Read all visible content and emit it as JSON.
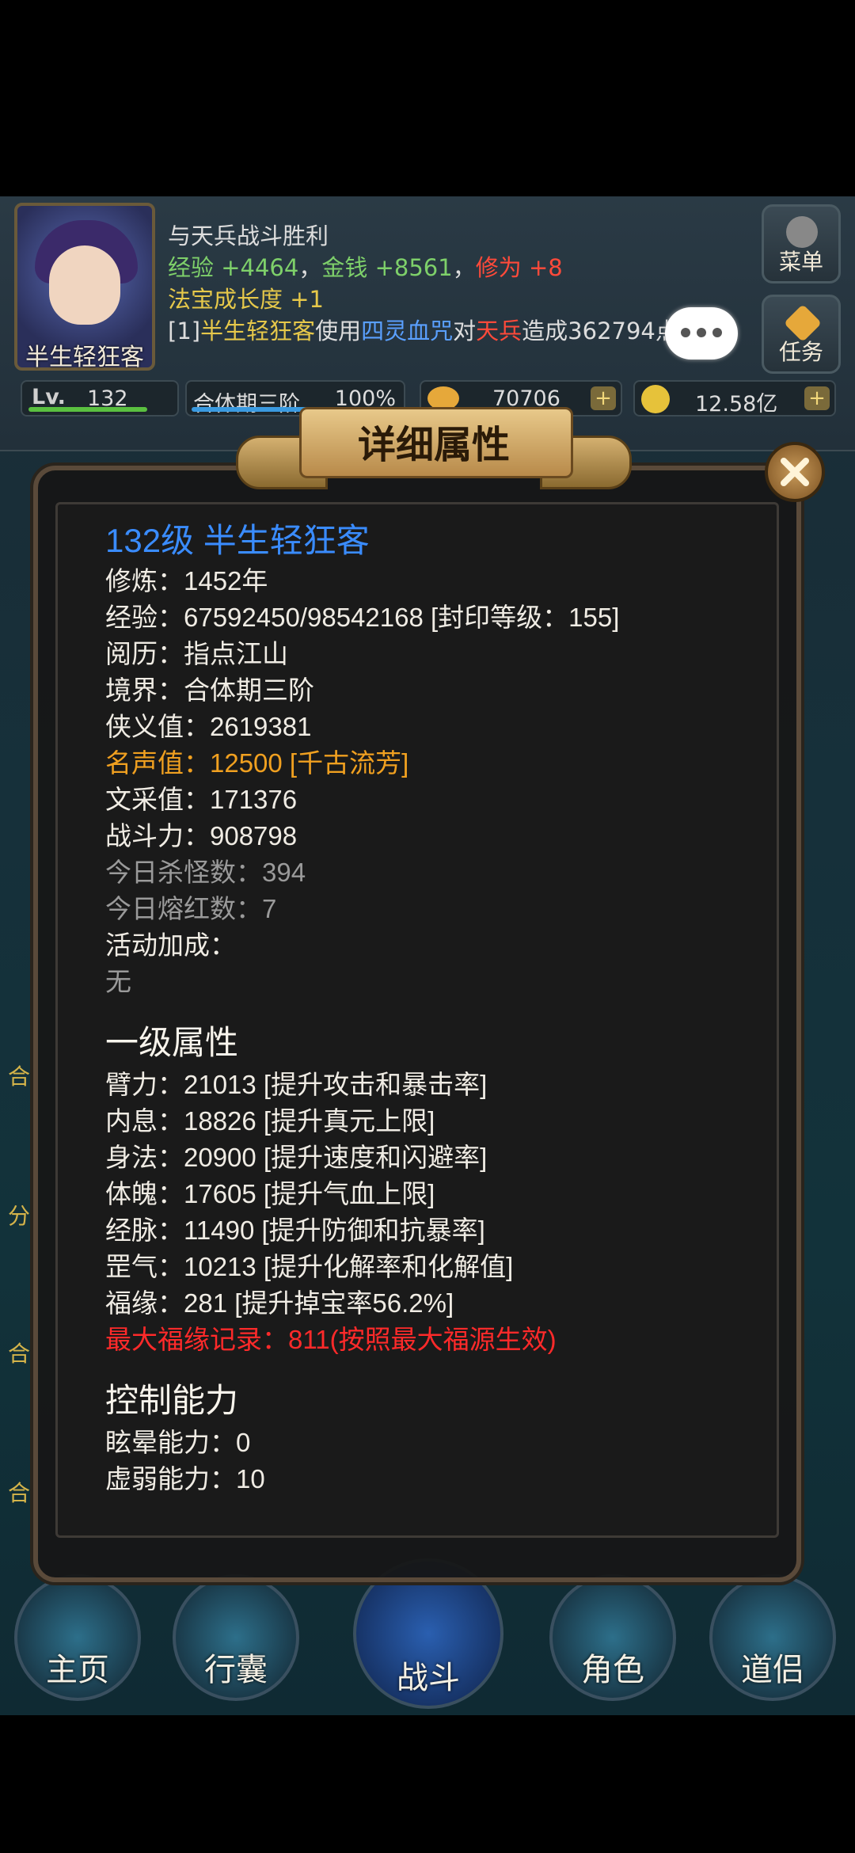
{
  "hud": {
    "player_name": "半生轻狂客",
    "log": {
      "line1": "与天兵战斗胜利",
      "exp_label": "经验",
      "exp_gain": "+4464",
      "comma1": "，",
      "money_label": "金钱",
      "money_gain": "+8561",
      "comma2": "，",
      "cult_label": "修为",
      "cult_gain": "+8",
      "treasure_label": "法宝成长度",
      "treasure_gain": "+1",
      "l4_prefix": "[1]",
      "l4_name": "半生轻狂客",
      "l4_use": "使用",
      "l4_skill": "四灵血咒",
      "l4_dui": "对",
      "l4_target": "天兵",
      "l4_rest": "造成362794点伤害"
    },
    "menu_label": "菜单",
    "task_label": "任务",
    "level_text": "132",
    "realm_text": "合体期三阶",
    "realm_percent": "100%",
    "gems": "70706",
    "gold": "12.58亿"
  },
  "side_labels": [
    "合",
    "分",
    "合",
    "合"
  ],
  "modal": {
    "title": "详细属性",
    "header": "132级 半生轻狂客",
    "basic": [
      "修炼：1452年",
      "经验：67592450/98542168 [封印等级：155]",
      "阅历：指点江山",
      "境界：合体期三阶",
      "侠义值：2619381",
      "名声值：12500 [千古流芳]",
      "文采值：171376",
      "战斗力：908798",
      "今日杀怪数：394",
      "今日熔红数：7",
      "活动加成：",
      "无"
    ],
    "section1": "一级属性",
    "attributes": [
      "臂力：21013 [提升攻击和暴击率]",
      "内息：18826 [提升真元上限]",
      "身法：20900 [提升速度和闪避率]",
      "体魄：17605 [提升气血上限]",
      "经脉：11490 [提升防御和抗暴率]",
      "罡气：10213 [提升化解率和化解值]",
      "福缘：281 [提升掉宝率56.2%]",
      "最大福缘记录：811(按照最大福源生效)"
    ],
    "section2": "控制能力",
    "control": [
      "眩晕能力：0",
      "虚弱能力：10"
    ]
  },
  "nav": {
    "home": "主页",
    "bag": "行囊",
    "battle": "战斗",
    "role": "角色",
    "partner": "道侣"
  },
  "colors": {
    "exp_green": "#7ed06a",
    "cult_red": "#ff4a3a",
    "header_blue": "#3a8cff",
    "fame_orange": "#f0a020",
    "record_red": "#ff2a2a"
  }
}
